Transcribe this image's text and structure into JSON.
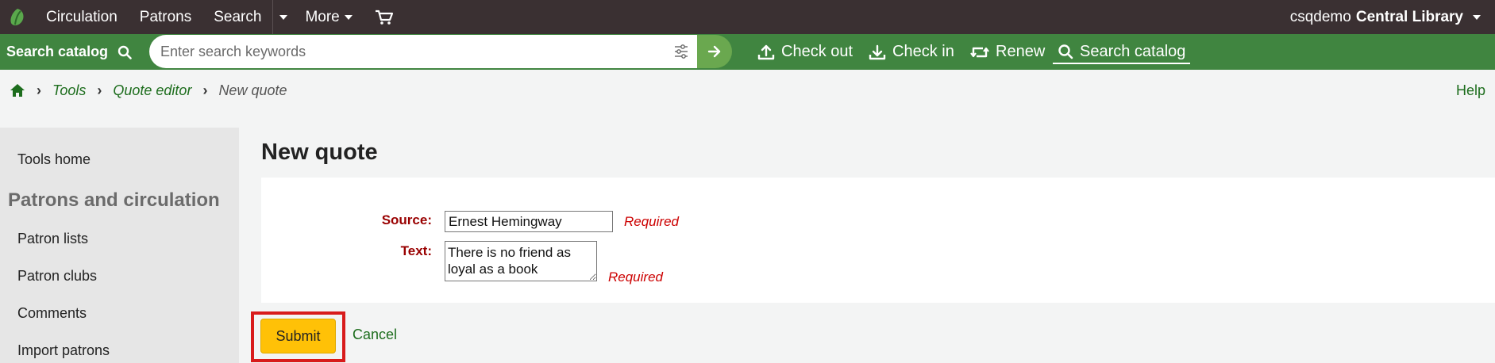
{
  "topnav": {
    "items": [
      "Circulation",
      "Patrons",
      "Search",
      "More"
    ],
    "user": "csqdemo",
    "library": "Central Library"
  },
  "searchbar": {
    "label": "Search catalog",
    "placeholder": "Enter search keywords",
    "links": [
      "Check out",
      "Check in",
      "Renew",
      "Search catalog"
    ]
  },
  "breadcrumb": {
    "items": [
      "Tools",
      "Quote editor"
    ],
    "current": "New quote",
    "help": "Help"
  },
  "sidebar": {
    "tools_home": "Tools home",
    "heading": "Patrons and circulation",
    "links": [
      "Patron lists",
      "Patron clubs",
      "Comments",
      "Import patrons"
    ]
  },
  "main": {
    "title": "New quote",
    "source_label": "Source:",
    "source_value": "Ernest Hemingway",
    "text_label": "Text:",
    "text_value": "There is no friend as loyal as a book",
    "required": "Required",
    "submit": "Submit",
    "cancel": "Cancel"
  },
  "colors": {
    "topbar": "#3a3032",
    "searchbar": "#408540",
    "link": "#1d6d1d",
    "submit": "#ffc107",
    "highlight": "#d81b1b"
  }
}
